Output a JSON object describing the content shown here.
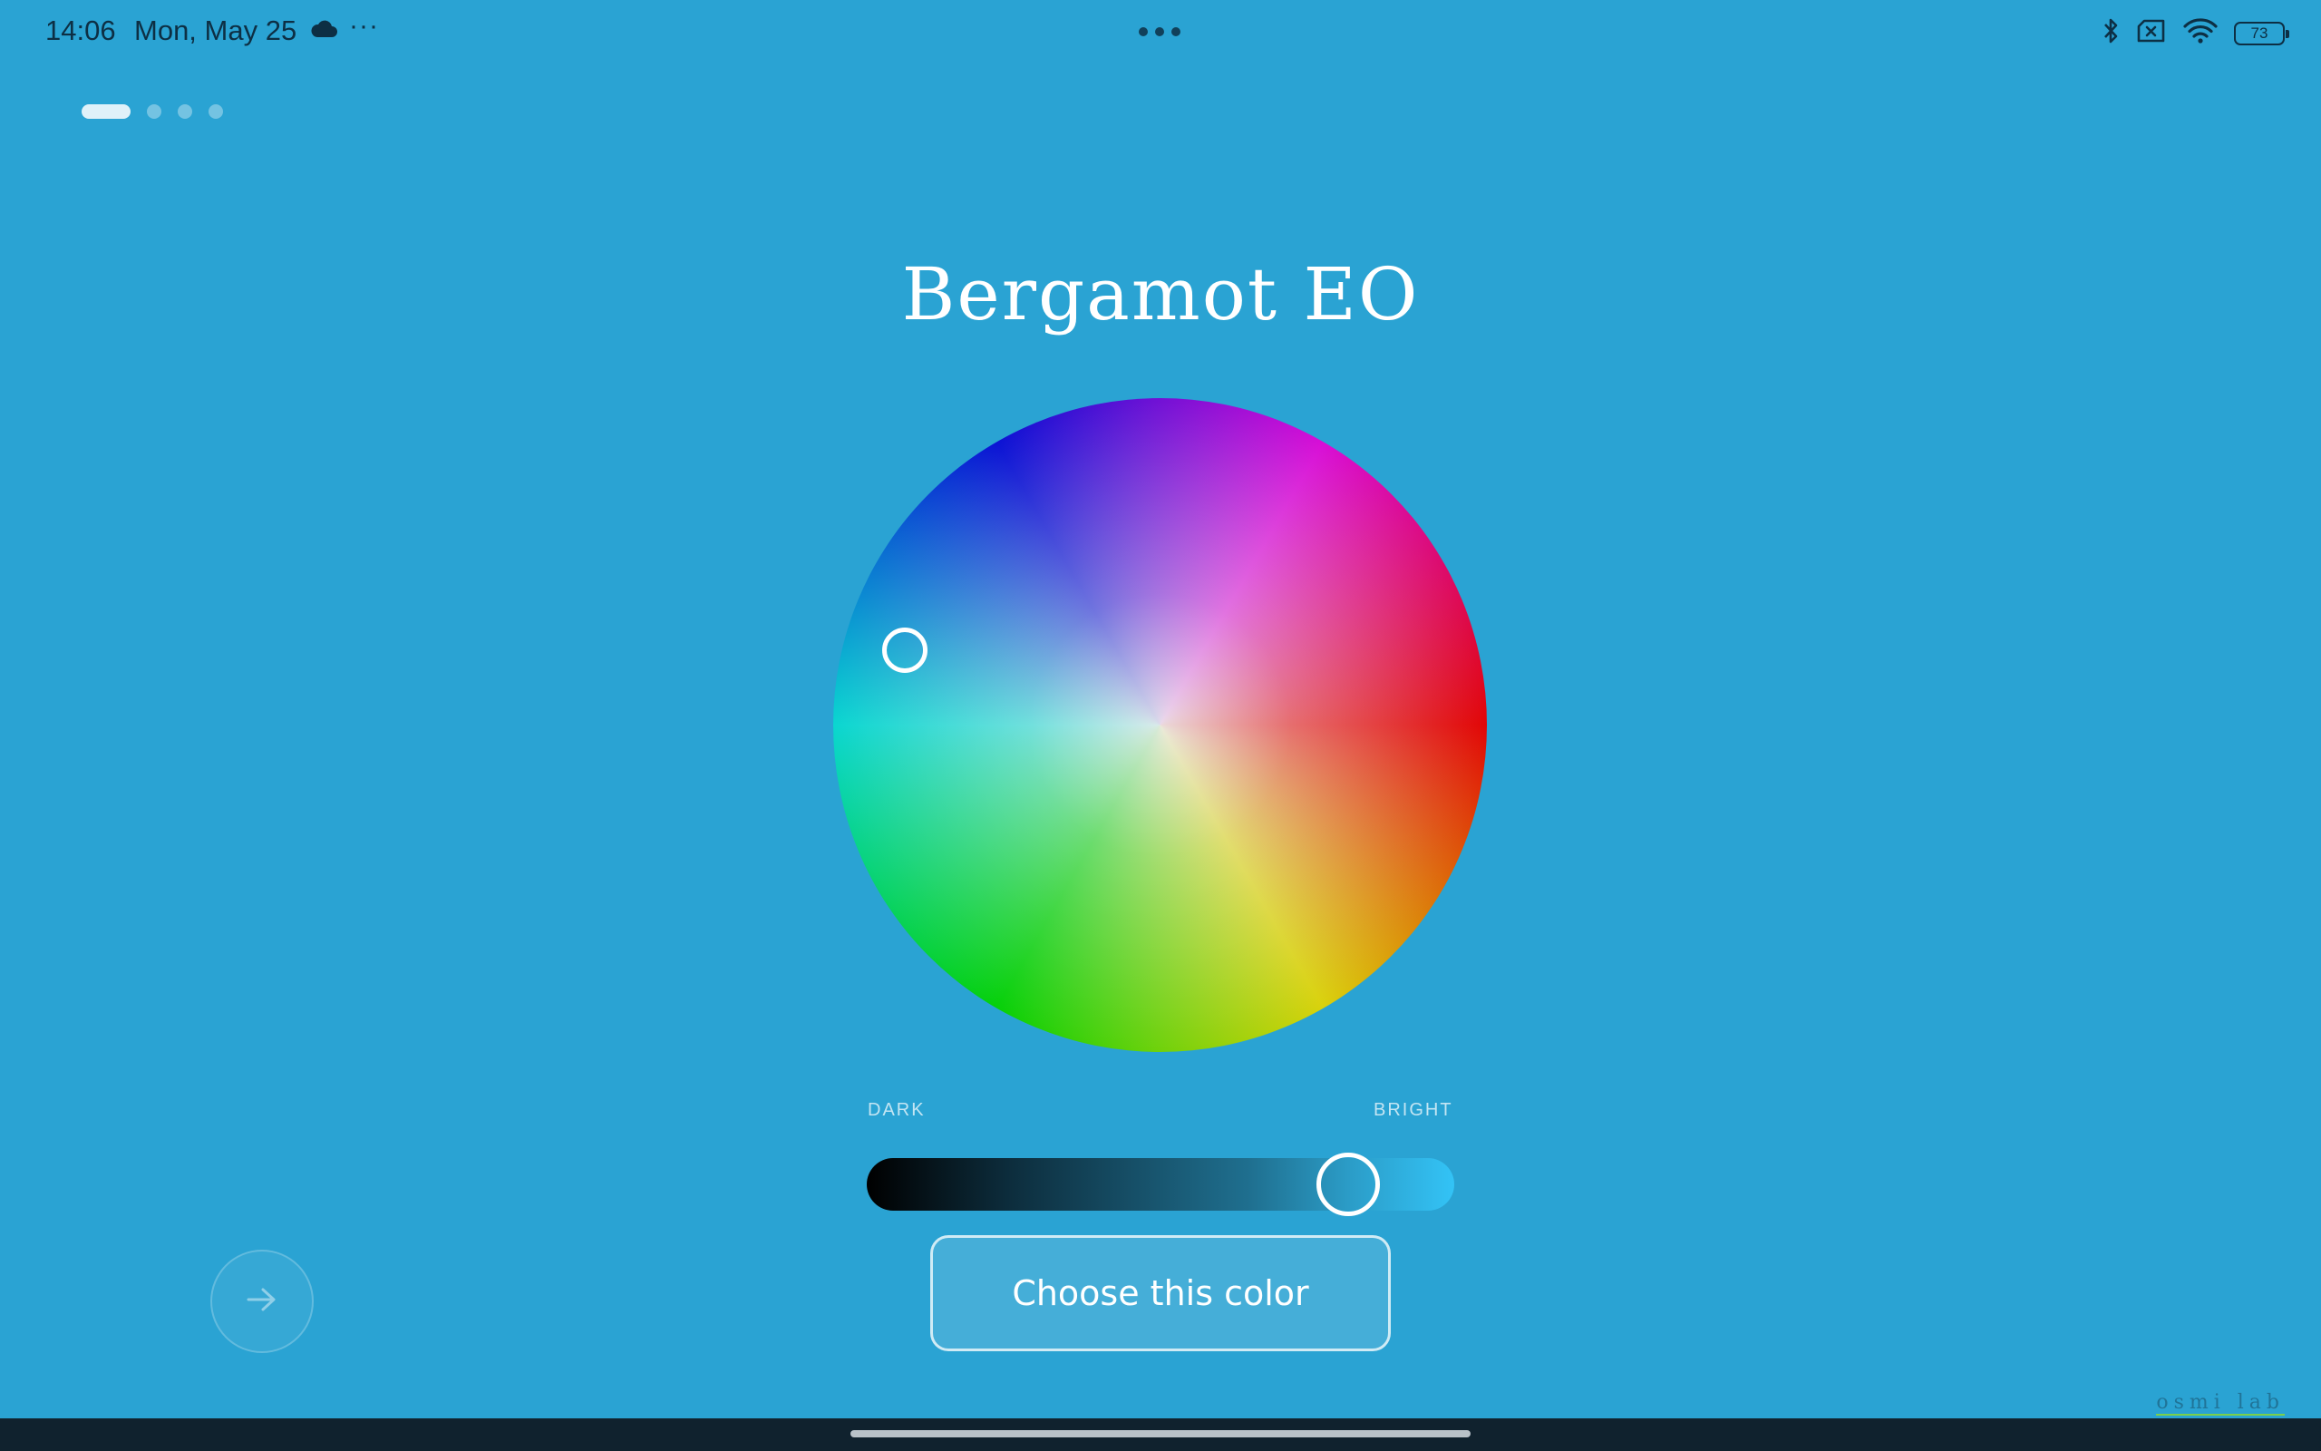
{
  "status_bar": {
    "time": "14:06",
    "date": "Mon, May 25",
    "more_indicator": "···",
    "battery_level": "73",
    "icons": [
      "cloud-icon",
      "bluetooth-icon",
      "sim-disabled-icon",
      "wifi-icon",
      "battery-icon"
    ]
  },
  "pager": {
    "page_count": 4,
    "current_page": 1
  },
  "product": {
    "name": "Bergamot EO"
  },
  "brightness": {
    "dark_label": "DARK",
    "bright_label": "BRIGHT",
    "level_fraction": 0.82
  },
  "actions": {
    "choose_label": "Choose this color",
    "next_icon": "arrow-right-icon"
  },
  "watermark": "osmi lab",
  "colors": {
    "background": "#2aa3d3",
    "text_dark": "#0d2f44",
    "nav_bar": "#10222e"
  }
}
